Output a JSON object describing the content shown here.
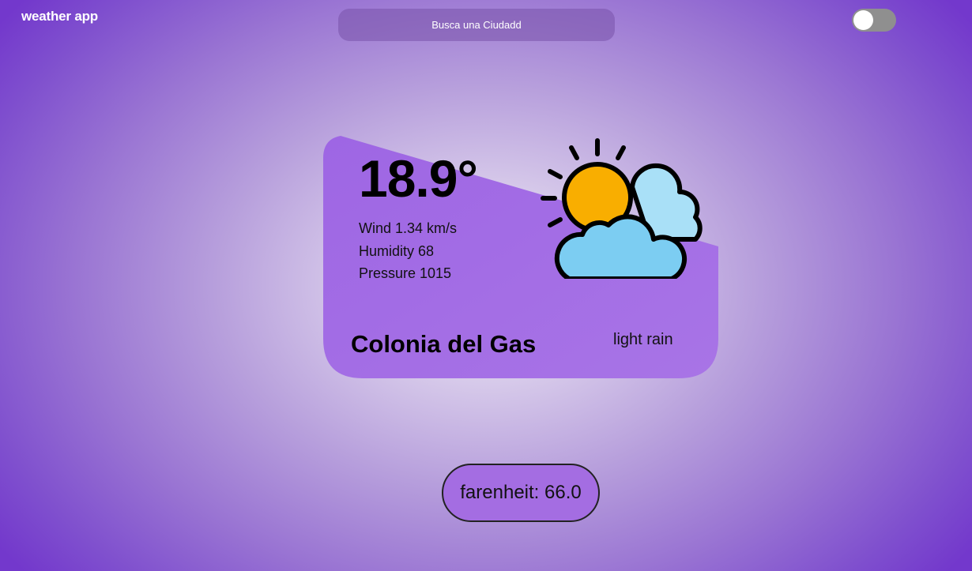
{
  "app": {
    "title": "weather app"
  },
  "search": {
    "placeholder": "Busca una Ciudadd"
  },
  "theme_toggle": {
    "state": "off"
  },
  "weather": {
    "temperature": "18.9°",
    "wind": "Wind 1.34 km/s",
    "humidity": "Humidity 68",
    "pressure": "Pressure 1015",
    "city": "Colonia del Gas",
    "description": "light rain",
    "icon": "sun-behind-clouds-icon"
  },
  "unit_button": {
    "label": "farenheit: 66.0"
  },
  "colors": {
    "background_center": "#f3eef8",
    "background_edge": "#7338cc",
    "card": "#a46de2",
    "toggle_track": "#8f8f8f",
    "sun": "#f9ae00",
    "cloud_front": "#7ccdf2",
    "cloud_back": "#a9e0f7"
  }
}
